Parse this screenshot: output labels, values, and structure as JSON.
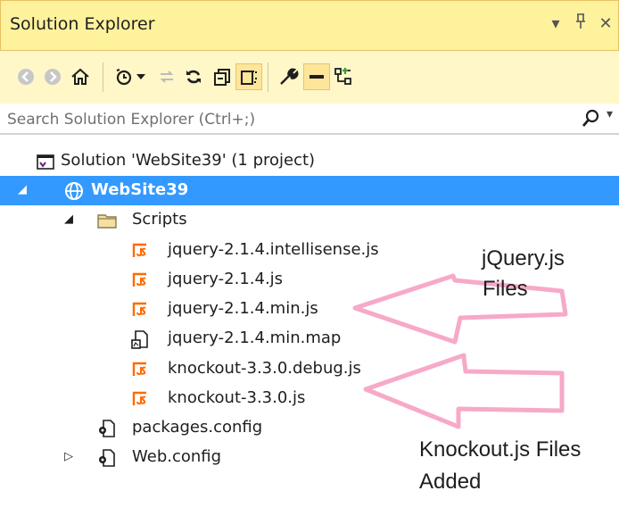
{
  "panel": {
    "title": "Solution Explorer",
    "title_controls": [
      "▾",
      "ᵖ",
      "✕"
    ]
  },
  "toolbar": {
    "icons": [
      "back-icon",
      "forward-icon",
      "home-icon",
      "pending-changes-icon",
      "dropdown-icon",
      "sync-icon",
      "refresh-icon",
      "collapse-all-icon",
      "show-all-files-icon",
      "properties-icon",
      "preview-selected-icon",
      "view-class-diagram-icon"
    ]
  },
  "search": {
    "placeholder": "Search Solution Explorer (Ctrl+;)"
  },
  "tree": {
    "solution": "Solution 'WebSite39' (1 project)",
    "project": "WebSite39",
    "folder": "Scripts",
    "files": [
      "jquery-2.1.4.intellisense.js",
      "jquery-2.1.4.js",
      "jquery-2.1.4.min.js",
      "jquery-2.1.4.min.map",
      "knockout-3.3.0.debug.js",
      "knockout-3.3.0.js"
    ],
    "config_files": [
      "packages.config",
      "Web.config"
    ]
  },
  "annotations": {
    "jquery_line1": "jQuery.js",
    "jquery_line2": "Files",
    "knockout_line1": "Knockout.js Files",
    "knockout_line2": "Added"
  },
  "colors": {
    "title_bg": "#fff29d",
    "toolbar_bg": "#fff7c7",
    "selection": "#3399ff",
    "js_icon": "#ff6a00",
    "arrow": "#f7a9c8"
  }
}
